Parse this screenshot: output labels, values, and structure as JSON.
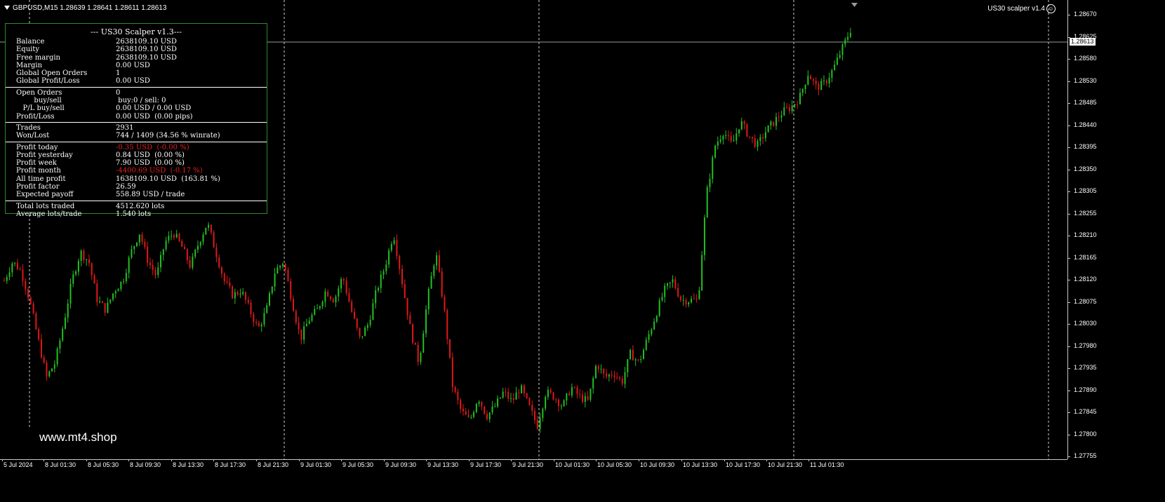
{
  "header": {
    "symbol_line": "GBPUSD,M15  1.28639 1.28641 1.28611 1.28613",
    "ea_name": "US30 scalper v1.4",
    "smiley_icon": "smiley-face-icon"
  },
  "watermark": "www.mt4.shop",
  "current_price": "1.28613",
  "price_axis": [
    "1.28670",
    "1.28625",
    "1.28580",
    "1.28530",
    "1.28485",
    "1.28440",
    "1.28395",
    "1.28350",
    "1.28305",
    "1.28255",
    "1.28210",
    "1.28165",
    "1.28120",
    "1.28075",
    "1.28030",
    "1.27980",
    "1.27935",
    "1.27890",
    "1.27845",
    "1.27800",
    "1.27755"
  ],
  "time_axis": [
    "5 Jul 2024",
    "8 Jul 01:30",
    "8 Jul 05:30",
    "8 Jul 09:30",
    "8 Jul 13:30",
    "8 Jul 17:30",
    "8 Jul 21:30",
    "9 Jul 01:30",
    "9 Jul 05:30",
    "9 Jul 09:30",
    "9 Jul 13:30",
    "9 Jul 17:30",
    "9 Jul 21:30",
    "10 Jul 01:30",
    "10 Jul 05:30",
    "10 Jul 09:30",
    "10 Jul 13:30",
    "10 Jul 17:30",
    "10 Jul 21:30",
    "11 Jul 01:30"
  ],
  "colors": {
    "bull": "#22c022",
    "bear": "#e01818",
    "panel_border": "#2e8b2e",
    "negative": "#e02020"
  },
  "panel": {
    "title": "--- US30 Scalper v1.3---",
    "sections": [
      [
        {
          "label": "Balance",
          "value": "2638109.10 USD"
        },
        {
          "label": "Equity",
          "value": "2638109.10 USD"
        },
        {
          "label": "Free margin",
          "value": "2638109.10 USD"
        },
        {
          "label": "Margin",
          "value": "0.00 USD"
        },
        {
          "label": "Global Open Orders",
          "value": "1"
        },
        {
          "label": "Global Profit/Loss",
          "value": "0.00 USD"
        }
      ],
      [
        {
          "label": "Open Orders",
          "value": "0"
        },
        {
          "label": "        buy/sell",
          "value": " buy:0 / sell: 0"
        },
        {
          "label": "   P/L buy/sell",
          "value": "0.00 USD / 0.00 USD"
        },
        {
          "label": "Profit/Loss",
          "value": "0.00 USD  (0.00 pips)"
        }
      ],
      [
        {
          "label": "Trades",
          "value": "2931"
        },
        {
          "label": "Won/Lost",
          "value": "744 / 1409 (34.56 % winrate)"
        }
      ],
      [
        {
          "label": "Profit today",
          "value": "-0.35 USD  (-0.00 %)",
          "negative": true
        },
        {
          "label": "Profit yesterday",
          "value": "0.84 USD  (0.00 %)"
        },
        {
          "label": "Profit week",
          "value": "7.90 USD  (0.00 %)"
        },
        {
          "label": "Profit month",
          "value": "-4400.69 USD  (-0.17 %)",
          "negative": true
        },
        {
          "label": "All time profit",
          "value": "1638109.10 USD  (163.81 %)"
        },
        {
          "label": "Profit factor",
          "value": "26.59"
        },
        {
          "label": "Expected payoff",
          "value": "558.89 USD / trade"
        }
      ],
      [
        {
          "label": "Total lots traded",
          "value": "4512.620 lots"
        },
        {
          "label": "Average lots/trade",
          "value": "1.540 lots"
        }
      ]
    ]
  },
  "chart_data": {
    "type": "candlestick",
    "symbol": "GBPUSD",
    "timeframe": "M15",
    "ylim": [
      1.27755,
      1.2869
    ],
    "series_close": [
      1.2812,
      1.2816,
      1.2814,
      1.2808,
      1.28,
      1.2792,
      1.2795,
      1.2803,
      1.2812,
      1.2818,
      1.2816,
      1.2808,
      1.2806,
      1.281,
      1.2812,
      1.2818,
      1.2822,
      1.2816,
      1.2813,
      1.282,
      1.2822,
      1.2819,
      1.2815,
      1.282,
      1.2824,
      1.2818,
      1.2812,
      1.2809,
      1.281,
      1.2806,
      1.2802,
      1.2806,
      1.2814,
      1.2816,
      1.2808,
      1.28,
      1.2804,
      1.2806,
      1.281,
      1.2808,
      1.2813,
      1.2806,
      1.28,
      1.2803,
      1.281,
      1.2815,
      1.2822,
      1.2812,
      1.2802,
      1.2795,
      1.2808,
      1.2818,
      1.2806,
      1.279,
      1.2785,
      1.2783,
      1.2788,
      1.2784,
      1.2786,
      1.2789,
      1.2787,
      1.279,
      1.2786,
      1.2782,
      1.2789,
      1.2788,
      1.2786,
      1.279,
      1.2788,
      1.2787,
      1.2795,
      1.2792,
      1.2793,
      1.2791,
      1.2797,
      1.2795,
      1.28,
      1.2805,
      1.281,
      1.2812,
      1.2808,
      1.2808,
      1.2808,
      1.283,
      1.284,
      1.2843,
      1.284,
      1.2845,
      1.2842,
      1.284,
      1.2843,
      1.2845,
      1.2847,
      1.2848,
      1.285,
      1.2855,
      1.2852,
      1.2853,
      1.2856,
      1.286,
      1.2864
    ]
  }
}
